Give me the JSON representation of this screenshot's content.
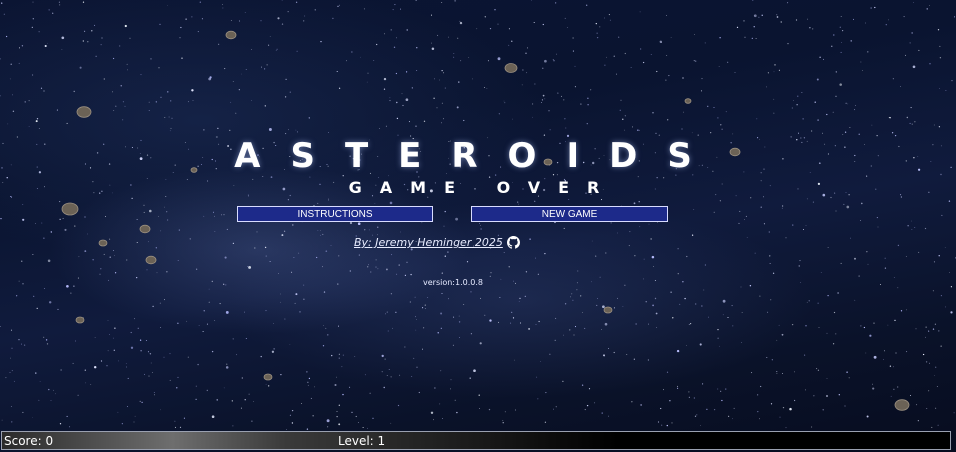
{
  "game": {
    "title": "ASTEROIDS",
    "subtitle": "GAME OVER"
  },
  "menu": {
    "instructions_label": "INSTRUCTIONS",
    "new_game_label": "NEW GAME"
  },
  "credit": {
    "text": "By: Jeremy Heminger 2025",
    "icon": "github-icon"
  },
  "version": "version:1.0.0.8",
  "status_bar": {
    "score": "Score: 0",
    "level": "Level: 1"
  },
  "colors": {
    "button_bg": "#1d2a8a",
    "button_border": "#d8dcff",
    "text": "#ffffff"
  }
}
